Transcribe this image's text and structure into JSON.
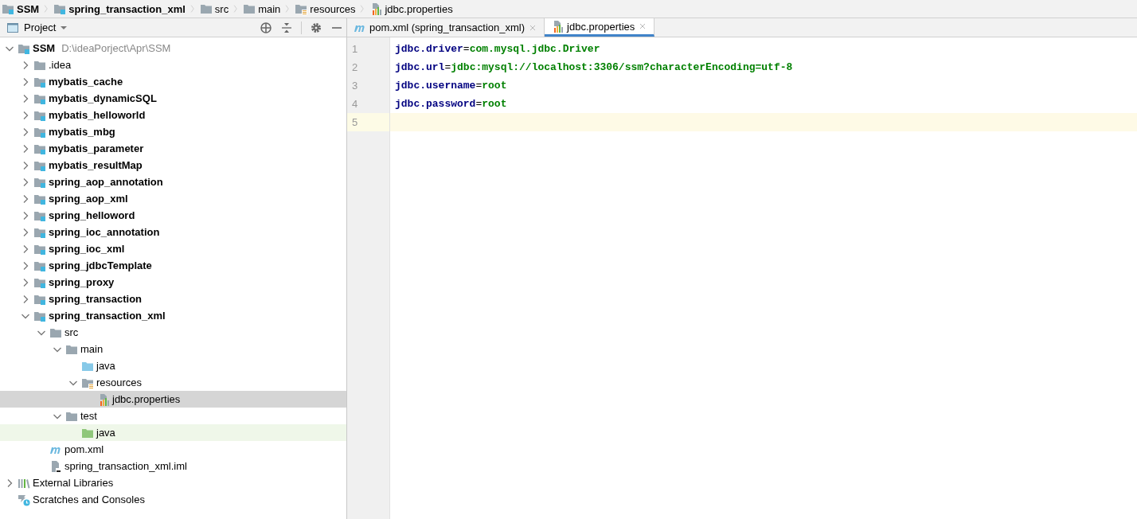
{
  "breadcrumbs": [
    {
      "label": "SSM",
      "kind": "module",
      "bold": true
    },
    {
      "label": "spring_transaction_xml",
      "kind": "module",
      "bold": true
    },
    {
      "label": "src",
      "kind": "folder",
      "bold": false
    },
    {
      "label": "main",
      "kind": "folder",
      "bold": false
    },
    {
      "label": "resources",
      "kind": "resources-folder",
      "bold": false
    },
    {
      "label": "jdbc.properties",
      "kind": "properties",
      "bold": false
    }
  ],
  "project_panel": {
    "title": "Project",
    "tree": [
      {
        "label": "SSM",
        "kind": "module",
        "hint": "D:\\ideaPorject\\Apr\\SSM",
        "expanded": true,
        "selected": false,
        "children": [
          {
            "label": ".idea",
            "kind": "folder",
            "expanded": false,
            "selected": false
          },
          {
            "label": "mybatis_cache",
            "kind": "module",
            "expanded": false,
            "selected": false
          },
          {
            "label": "mybatis_dynamicSQL",
            "kind": "module",
            "expanded": false,
            "selected": false
          },
          {
            "label": "mybatis_helloworld",
            "kind": "module",
            "expanded": false,
            "selected": false
          },
          {
            "label": "mybatis_mbg",
            "kind": "module",
            "expanded": false,
            "selected": false
          },
          {
            "label": "mybatis_parameter",
            "kind": "module",
            "expanded": false,
            "selected": false
          },
          {
            "label": "mybatis_resultMap",
            "kind": "module",
            "expanded": false,
            "selected": false
          },
          {
            "label": "spring_aop_annotation",
            "kind": "module",
            "expanded": false,
            "selected": false
          },
          {
            "label": "spring_aop_xml",
            "kind": "module",
            "expanded": false,
            "selected": false
          },
          {
            "label": "spring_helloword",
            "kind": "module",
            "expanded": false,
            "selected": false
          },
          {
            "label": "spring_ioc_annotation",
            "kind": "module",
            "expanded": false,
            "selected": false
          },
          {
            "label": "spring_ioc_xml",
            "kind": "module",
            "expanded": false,
            "selected": false
          },
          {
            "label": "spring_jdbcTemplate",
            "kind": "module",
            "expanded": false,
            "selected": false
          },
          {
            "label": "spring_proxy",
            "kind": "module",
            "expanded": false,
            "selected": false
          },
          {
            "label": "spring_transaction",
            "kind": "module",
            "expanded": false,
            "selected": false
          },
          {
            "label": "spring_transaction_xml",
            "kind": "module",
            "expanded": true,
            "selected": false,
            "children": [
              {
                "label": "src",
                "kind": "folder",
                "expanded": true,
                "selected": false,
                "children": [
                  {
                    "label": "main",
                    "kind": "folder",
                    "expanded": true,
                    "selected": false,
                    "children": [
                      {
                        "label": "java",
                        "kind": "source-folder",
                        "selected": false
                      },
                      {
                        "label": "resources",
                        "kind": "resources-folder",
                        "expanded": true,
                        "selected": false,
                        "children": [
                          {
                            "label": "jdbc.properties",
                            "kind": "properties",
                            "selected": true
                          }
                        ]
                      }
                    ]
                  },
                  {
                    "label": "test",
                    "kind": "folder",
                    "expanded": true,
                    "selected": false,
                    "children": [
                      {
                        "label": "java",
                        "kind": "test-folder",
                        "selected": false
                      }
                    ]
                  }
                ]
              },
              {
                "label": "pom.xml",
                "kind": "maven",
                "selected": false
              },
              {
                "label": "spring_transaction_xml.iml",
                "kind": "iml",
                "selected": false
              }
            ]
          }
        ]
      },
      {
        "label": "External Libraries",
        "kind": "libraries",
        "expanded": false,
        "selected": false
      },
      {
        "label": "Scratches and Consoles",
        "kind": "scratches",
        "selected": false
      }
    ]
  },
  "editor": {
    "tabs": [
      {
        "label": "pom.xml (spring_transaction_xml)",
        "kind": "maven",
        "selected": false
      },
      {
        "label": "jdbc.properties",
        "kind": "properties",
        "selected": true
      }
    ],
    "lines": [
      {
        "number": "1",
        "key": "jdbc.driver",
        "separator": "=",
        "value": "com.mysql.jdbc.Driver",
        "current": false
      },
      {
        "number": "2",
        "key": "jdbc.url",
        "separator": "=",
        "value": "jdbc:mysql://localhost:3306/ssm?characterEncoding=utf-8",
        "current": false
      },
      {
        "number": "3",
        "key": "jdbc.username",
        "separator": "=",
        "value": "root",
        "current": false
      },
      {
        "number": "4",
        "key": "jdbc.password",
        "separator": "=",
        "value": "root",
        "current": false
      },
      {
        "number": "5",
        "current": true
      }
    ]
  }
}
